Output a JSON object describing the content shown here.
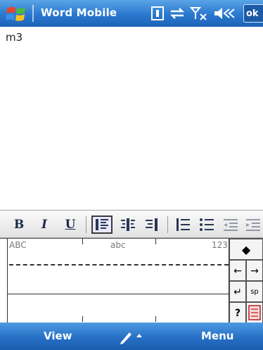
{
  "title_bar": {
    "app_title": "Word Mobile",
    "ok_label": "ok"
  },
  "document": {
    "text": "m3"
  },
  "format_toolbar": {
    "bold_label": "B",
    "italic_label": "I",
    "underline_label": "U",
    "align_left_active": true
  },
  "input_panel": {
    "zone_uppercase_label": "ABC",
    "zone_lowercase_label": "abc",
    "zone_numbers_label": "123",
    "keys": {
      "backspace": "◆",
      "left": "←",
      "right": "→",
      "enter": "↵",
      "space": "sp",
      "help": "?"
    }
  },
  "softkeys": {
    "left_label": "View",
    "right_label": "Menu"
  },
  "colors": {
    "titlebar_blue": "#2a78cf",
    "softbar_blue": "#2670c6"
  }
}
